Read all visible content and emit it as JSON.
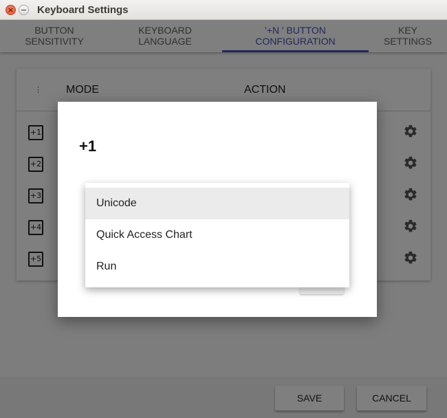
{
  "window": {
    "title": "Keyboard Settings",
    "close_glyph": "×",
    "minimize_glyph": "−"
  },
  "tabs": [
    {
      "line1": "BUTTON",
      "line2": "SENSITIVITY",
      "active": false
    },
    {
      "line1": "KEYBOARD",
      "line2": "LANGUAGE",
      "active": false
    },
    {
      "line1": "'+N ' BUTTON",
      "line2": "CONFIGURATION",
      "active": true
    },
    {
      "line1": "KEY",
      "line2": "SETTINGS",
      "active": false
    }
  ],
  "table": {
    "menu_glyph": "⋮",
    "headers": {
      "mode": "MODE",
      "action": "ACTION"
    },
    "rows": [
      {
        "label": "+1",
        "icon": "gear-icon"
      },
      {
        "label": "+2",
        "icon": "gear-icon"
      },
      {
        "label": "+3",
        "icon": "gear-icon"
      },
      {
        "label": "+4",
        "icon": "gear-icon"
      },
      {
        "label": "+5",
        "icon": "gear-icon"
      }
    ]
  },
  "footer": {
    "save_label": "SAVE",
    "cancel_label": "CANCEL"
  },
  "dialog": {
    "title": "+1",
    "dropdown_options": [
      "Unicode",
      "Quick Access Chart",
      "Run"
    ],
    "highlighted_option": "Unicode"
  },
  "colors": {
    "accent": "#3f51b5",
    "overlay": "rgba(0,0,0,0.5)",
    "menu_highlight": "#ebebeb"
  }
}
